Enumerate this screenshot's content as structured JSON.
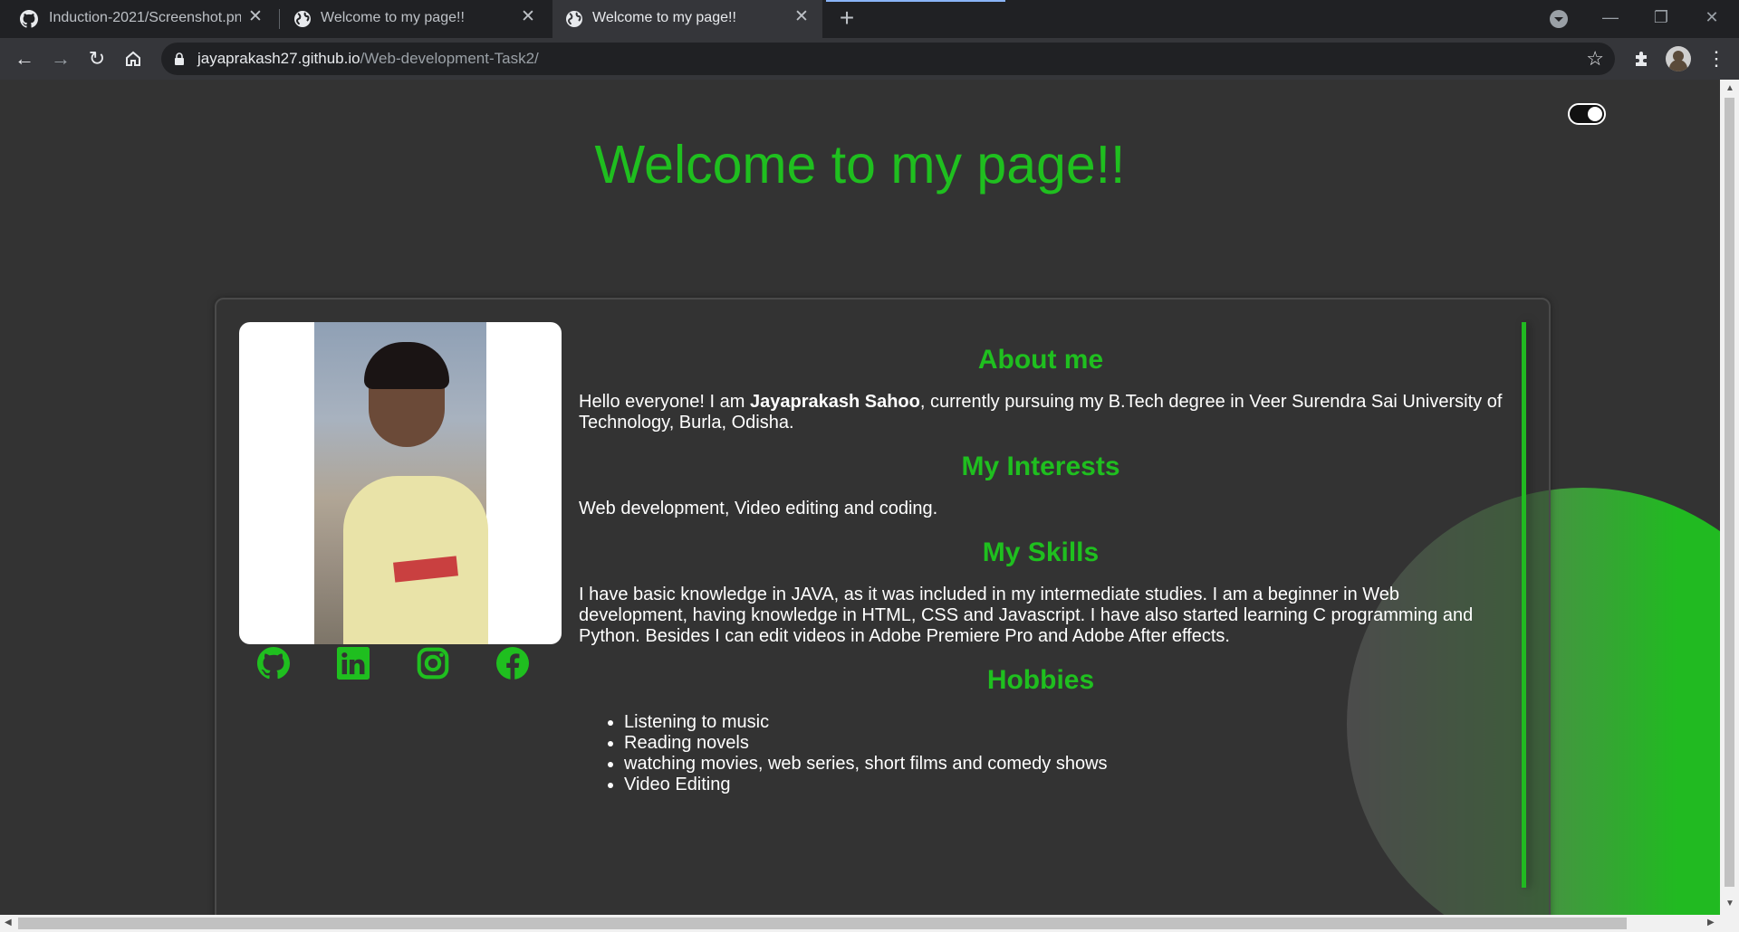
{
  "browser": {
    "tabs": [
      {
        "title": "Induction-2021/Screenshot.png at main · j",
        "icon": "github-icon",
        "active": false
      },
      {
        "title": "Welcome to my page!!",
        "icon": "globe-icon",
        "active": false
      },
      {
        "title": "Welcome to my page!!",
        "icon": "globe-icon",
        "active": true
      }
    ],
    "url_host": "jayaprakash27.github.io",
    "url_path": "/Web-development-Task2/"
  },
  "page": {
    "title": "Welcome to my page!!",
    "about": {
      "heading": "About me",
      "intro": "Hello everyone! I am ",
      "name": "Jayaprakash Sahoo",
      "rest": ", currently pursuing my B.Tech degree in Veer Surendra Sai University of Technology, Burla, Odisha."
    },
    "interests": {
      "heading": "My Interests",
      "text": "Web development, Video editing and coding."
    },
    "skills": {
      "heading": "My Skills",
      "text": "I have basic knowledge in JAVA, as it was included in my intermediate studies. I am a beginner in Web development, having knowledge in HTML, CSS and Javascript. I have also started learning C programming and Python. Besides I can edit videos in Adobe Premiere Pro and Adobe After effects."
    },
    "hobbies": {
      "heading": "Hobbies",
      "items": [
        "Listening to music",
        "Reading novels",
        "watching movies, web series, short films and comedy shows",
        "Video Editing"
      ]
    },
    "socials": [
      "github-icon",
      "linkedin-icon",
      "instagram-icon",
      "facebook-icon"
    ]
  },
  "colors": {
    "accent": "#1fbf1f",
    "background": "#333333"
  }
}
